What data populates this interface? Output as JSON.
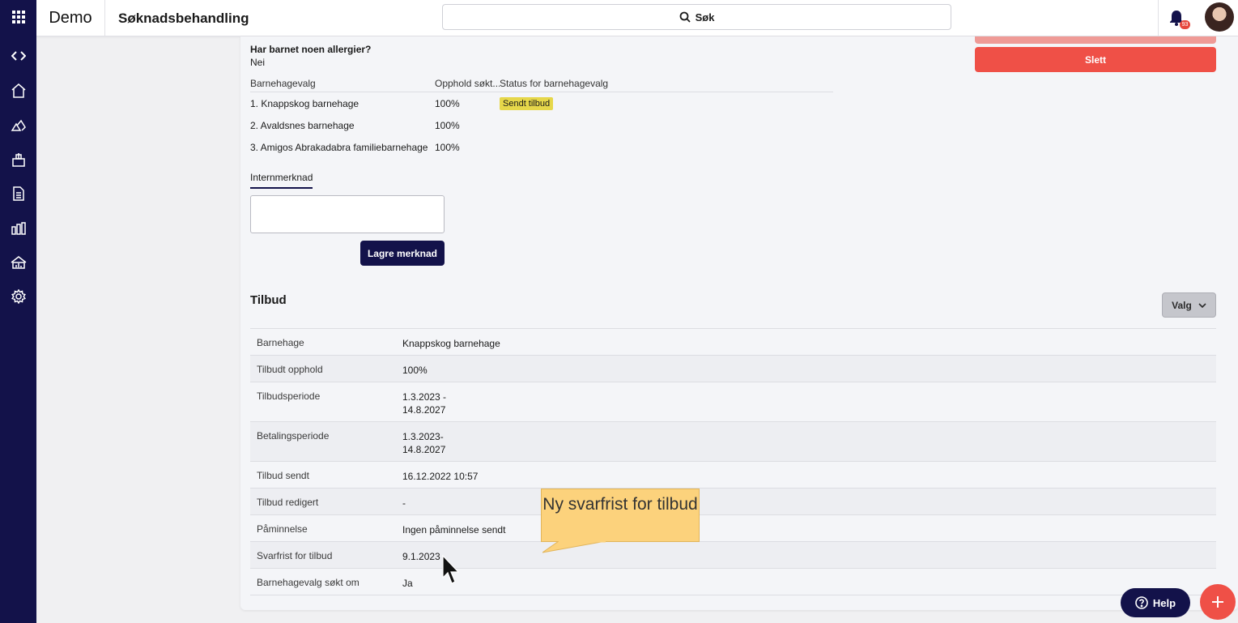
{
  "app": {
    "brand": "Demo",
    "page_title": "Søknadsbehandling",
    "notifications_count": "93"
  },
  "search": {
    "label": "Søk"
  },
  "sidebar": {
    "items": [
      {
        "icon": "apps-grid-icon"
      },
      {
        "icon": "code-toggle-icon"
      },
      {
        "icon": "home-icon"
      },
      {
        "icon": "kindergarten-icon"
      },
      {
        "icon": "building-icon"
      },
      {
        "icon": "document-icon"
      },
      {
        "icon": "bar-chart-icon"
      },
      {
        "icon": "house-chart-icon"
      },
      {
        "icon": "gear-icon"
      }
    ]
  },
  "application": {
    "allergy_question": "Har barnet noen allergier?",
    "allergy_answer": "Nei",
    "choices_headers": [
      "Barnehagevalg",
      "Opphold søkt...",
      "Status for barnehagevalg"
    ],
    "choices": [
      {
        "name": "1. Knappskog barnehage",
        "stay": "100%",
        "status": "Sendt tilbud"
      },
      {
        "name": "2. Avaldsnes barnehage",
        "stay": "100%",
        "status": ""
      },
      {
        "name": "3. Amigos Abrakadabra familiebarnehage",
        "stay": "100%",
        "status": ""
      }
    ],
    "internal_note_tab": "Internmerknad",
    "save_note_label": "Lagre merknad",
    "delete_label": "Slett"
  },
  "offer": {
    "title": "Tilbud",
    "options_label": "Valg",
    "rows": [
      {
        "key": "Barnehage",
        "value": [
          "Knappskog barnehage"
        ]
      },
      {
        "key": "Tilbudt opphold",
        "value": [
          "100%"
        ]
      },
      {
        "key": "Tilbudsperiode",
        "value": [
          "1.3.2023 -",
          "14.8.2027"
        ]
      },
      {
        "key": "Betalingsperiode",
        "value": [
          "1.3.2023-",
          "14.8.2027"
        ]
      },
      {
        "key": "Tilbud sendt",
        "value": [
          "16.12.2022 10:57"
        ]
      },
      {
        "key": "Tilbud redigert",
        "value": [
          "-"
        ]
      },
      {
        "key": "Påminnelse",
        "value": [
          "Ingen påminnelse sendt"
        ]
      },
      {
        "key": "Svarfrist for tilbud",
        "value": [
          "9.1.2023"
        ]
      },
      {
        "key": "Barnehagevalg søkt om",
        "value": [
          "Ja"
        ]
      }
    ]
  },
  "callout": {
    "text": "Ny svarfrist for tilbud"
  },
  "help": {
    "label": "Help"
  },
  "colors": {
    "navy": "#13124a",
    "danger": "#ef5047",
    "status_tag": "#e6d74a",
    "callout": "#fcd27c"
  }
}
